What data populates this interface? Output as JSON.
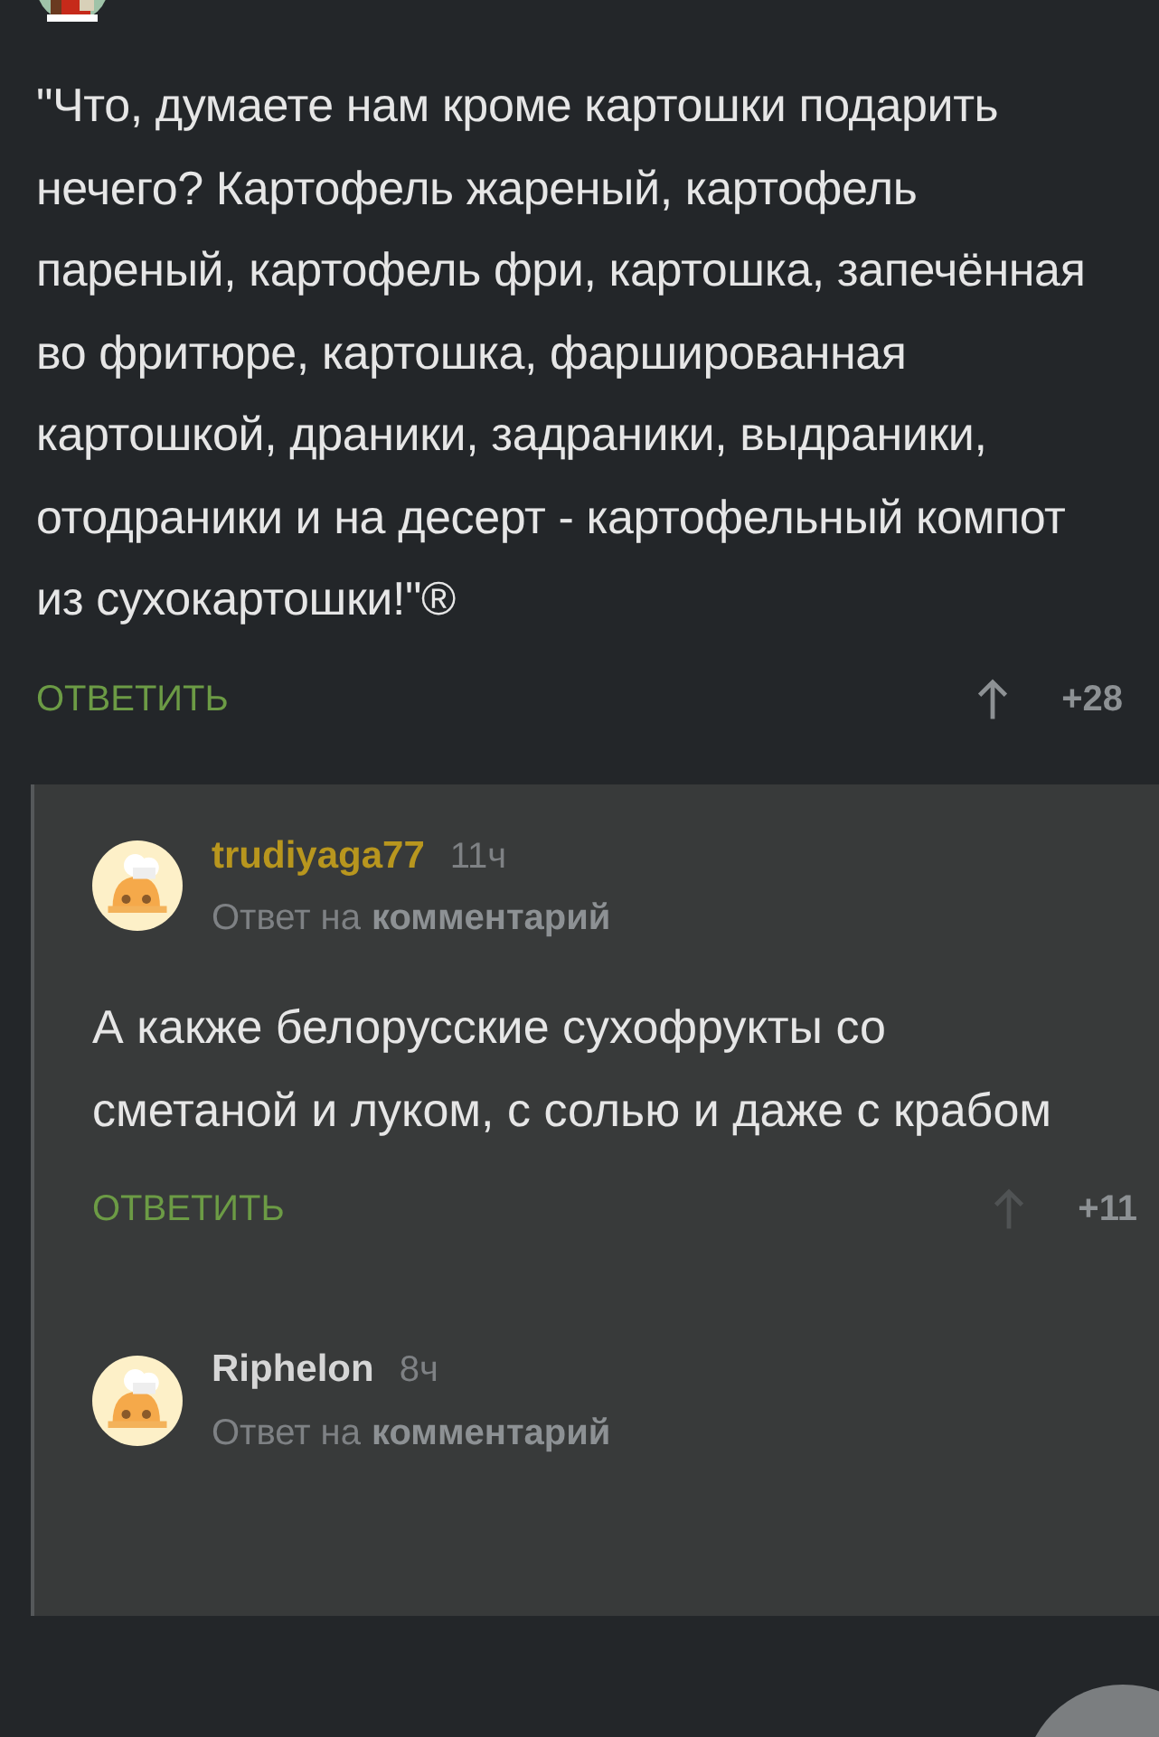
{
  "top_comment": {
    "text": "\"Что, думаете нам кроме картошки подарить нечего? Картофель жареный, картофель пареный, картофель фри, картошка, запечённая во фритюре, картошка, фаршированная картошкой, драники, задраники, выдраники, отодраники и на десерт - картофельный компот из сухокартошки!\"®",
    "reply": "ОТВЕТИТЬ",
    "score": "+28"
  },
  "replies": [
    {
      "author": "trudiyaga77",
      "color": "#b8961e",
      "time": "11ч",
      "reply_to_prefix": "Ответ на",
      "reply_to_link": "комментарий",
      "text": "А какже белорусские сухофрукты со сметаной и луком, с солью и даже с крабом",
      "reply": "ОТВЕТИТЬ",
      "score": "+11"
    },
    {
      "author": "Riphelon",
      "color": "#d6d6d6",
      "time": "8ч",
      "reply_to_prefix": "Ответ на",
      "reply_to_link": "комментарий"
    }
  ]
}
